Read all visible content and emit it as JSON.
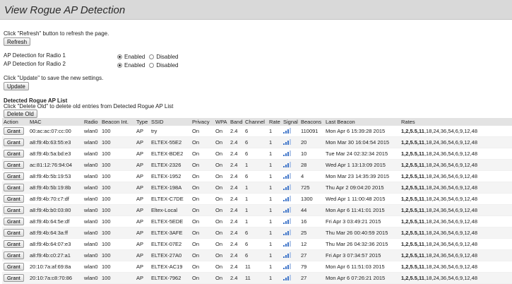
{
  "page": {
    "title": "View Rogue AP Detection",
    "refresh_hint": "Click \"Refresh\" button to refresh the page.",
    "refresh_label": "Refresh",
    "update_hint": "Click \"Update\" to save the new settings.",
    "update_label": "Update",
    "delete_hint": "Click \"Delete Old\" to delete old entries from Detected Rogue AP List",
    "delete_label": "Delete Old",
    "list_title": "Detected Rogue AP List"
  },
  "detection": [
    {
      "label": "AP Detection for Radio 1",
      "enabled": "Enabled",
      "disabled": "Disabled",
      "selected": "enabled"
    },
    {
      "label": "AP Detection for Radio 2",
      "enabled": "Enabled",
      "disabled": "Disabled",
      "selected": "enabled"
    }
  ],
  "table": {
    "headers": [
      "Action",
      "MAC",
      "Radio",
      "Beacon Int.",
      "Type",
      "SSID",
      "Privacy",
      "WPA",
      "Band",
      "Channel",
      "Rate",
      "Signal",
      "Beacons",
      "Last Beacon",
      "Rates"
    ],
    "rows": [
      {
        "action": "Grant",
        "mac": "00:ac:ac:07:cc:00",
        "radio": "wlan0",
        "beacon_int": "100",
        "type": "AP",
        "ssid": "try",
        "privacy": "On",
        "wpa": "On",
        "band": "2.4",
        "channel": "6",
        "rate": "1",
        "signal": "signal-bars-icon",
        "beacons": "110091",
        "last_beacon": "Mon Apr 6 15:39:28 2015",
        "rates_bold": "1,2,5.5,11",
        "rates_rest": ",18,24,36,54,6,9,12,48"
      },
      {
        "action": "Grant",
        "mac": "a8:f9:4b:63:55:e3",
        "radio": "wlan0",
        "beacon_int": "100",
        "type": "AP",
        "ssid": "ELTEX-55E2",
        "privacy": "On",
        "wpa": "On",
        "band": "2.4",
        "channel": "6",
        "rate": "1",
        "signal": "signal-bars-icon",
        "beacons": "20",
        "last_beacon": "Mon Mar 30 16:04:54 2015",
        "rates_bold": "1,2,5.5,11",
        "rates_rest": ",18,24,36,54,6,9,12,48"
      },
      {
        "action": "Grant",
        "mac": "a8:f9:4b:5a:bd:e3",
        "radio": "wlan0",
        "beacon_int": "100",
        "type": "AP",
        "ssid": "ELTEX-BDE2",
        "privacy": "On",
        "wpa": "On",
        "band": "2.4",
        "channel": "6",
        "rate": "1",
        "signal": "signal-bars-icon",
        "beacons": "10",
        "last_beacon": "Tue Mar 24 02:32:34 2015",
        "rates_bold": "1,2,5.5,11",
        "rates_rest": ",18,24,36,54,6,9,12,48"
      },
      {
        "action": "Grant",
        "mac": "ac:81:12:76:94:04",
        "radio": "wlan0",
        "beacon_int": "100",
        "type": "AP",
        "ssid": "ELTEX-2326",
        "privacy": "On",
        "wpa": "On",
        "band": "2.4",
        "channel": "1",
        "rate": "1",
        "signal": "signal-bars-icon",
        "beacons": "28",
        "last_beacon": "Wed Apr 1 13:13:09 2015",
        "rates_bold": "1,2,5.5,11",
        "rates_rest": ",18,24,36,54,6,9,12,48"
      },
      {
        "action": "Grant",
        "mac": "a8:f9:4b:5b:19:53",
        "radio": "wlan0",
        "beacon_int": "100",
        "type": "AP",
        "ssid": "ELTEX-1952",
        "privacy": "On",
        "wpa": "On",
        "band": "2.4",
        "channel": "6",
        "rate": "1",
        "signal": "signal-bars-icon",
        "beacons": "4",
        "last_beacon": "Mon Mar 23 14:35:39 2015",
        "rates_bold": "1,2,5.5,11",
        "rates_rest": ",18,24,36,54,6,9,12,48"
      },
      {
        "action": "Grant",
        "mac": "a8:f9:4b:5b:19:8b",
        "radio": "wlan0",
        "beacon_int": "100",
        "type": "AP",
        "ssid": "ELTEX-198A",
        "privacy": "On",
        "wpa": "On",
        "band": "2.4",
        "channel": "1",
        "rate": "1",
        "signal": "signal-bars-icon",
        "beacons": "725",
        "last_beacon": "Thu Apr 2 09:04:20 2015",
        "rates_bold": "1,2,5.5,11",
        "rates_rest": ",18,24,36,54,6,9,12,48"
      },
      {
        "action": "Grant",
        "mac": "a8:f9:4b:70:c7:df",
        "radio": "wlan0",
        "beacon_int": "100",
        "type": "AP",
        "ssid": "ELTEX-C7DE",
        "privacy": "On",
        "wpa": "On",
        "band": "2.4",
        "channel": "1",
        "rate": "1",
        "signal": "signal-bars-icon",
        "beacons": "1300",
        "last_beacon": "Wed Apr 1 11:00:48 2015",
        "rates_bold": "1,2,5.5,11",
        "rates_rest": ",18,24,36,54,6,9,12,48"
      },
      {
        "action": "Grant",
        "mac": "a8:f9:4b:b0:03:80",
        "radio": "wlan0",
        "beacon_int": "100",
        "type": "AP",
        "ssid": "Eltex-Local",
        "privacy": "On",
        "wpa": "On",
        "band": "2.4",
        "channel": "1",
        "rate": "1",
        "signal": "signal-bars-icon",
        "beacons": "44",
        "last_beacon": "Mon Apr 6 11:41:01 2015",
        "rates_bold": "1,2,5.5,11",
        "rates_rest": ",18,24,36,54,6,9,12,48"
      },
      {
        "action": "Grant",
        "mac": "a8:f9:4b:64:5e:df",
        "radio": "wlan0",
        "beacon_int": "100",
        "type": "AP",
        "ssid": "ELTEX-5EDE",
        "privacy": "On",
        "wpa": "On",
        "band": "2.4",
        "channel": "1",
        "rate": "1",
        "signal": "signal-bars-icon",
        "beacons": "16",
        "last_beacon": "Fri Apr 3 03:49:21 2015",
        "rates_bold": "1,2,5.5,11",
        "rates_rest": ",18,24,36,54,6,9,12,48"
      },
      {
        "action": "Grant",
        "mac": "a8:f9:4b:64:3a:ff",
        "radio": "wlan0",
        "beacon_int": "100",
        "type": "AP",
        "ssid": "ELTEX-3AFE",
        "privacy": "On",
        "wpa": "On",
        "band": "2.4",
        "channel": "6",
        "rate": "1",
        "signal": "signal-bars-icon",
        "beacons": "25",
        "last_beacon": "Thu Mar 26 00:40:59 2015",
        "rates_bold": "1,2,5.5,11",
        "rates_rest": ",18,24,36,54,6,9,12,48"
      },
      {
        "action": "Grant",
        "mac": "a8:f9:4b:64:07:e3",
        "radio": "wlan0",
        "beacon_int": "100",
        "type": "AP",
        "ssid": "ELTEX-07E2",
        "privacy": "On",
        "wpa": "On",
        "band": "2.4",
        "channel": "6",
        "rate": "1",
        "signal": "signal-bars-icon",
        "beacons": "12",
        "last_beacon": "Thu Mar 26 04:32:36 2015",
        "rates_bold": "1,2,5.5,11",
        "rates_rest": ",18,24,36,54,6,9,12,48"
      },
      {
        "action": "Grant",
        "mac": "a8:f9:4b:c0:27:a1",
        "radio": "wlan0",
        "beacon_int": "100",
        "type": "AP",
        "ssid": "ELTEX-27A0",
        "privacy": "On",
        "wpa": "On",
        "band": "2.4",
        "channel": "6",
        "rate": "1",
        "signal": "signal-bars-icon",
        "beacons": "27",
        "last_beacon": "Fri Apr 3 07:34:57 2015",
        "rates_bold": "1,2,5.5,11",
        "rates_rest": ",18,24,36,54,6,9,12,48"
      },
      {
        "action": "Grant",
        "mac": "20:10:7a:af:69:8a",
        "radio": "wlan0",
        "beacon_int": "100",
        "type": "AP",
        "ssid": "ELTEX-AC19",
        "privacy": "On",
        "wpa": "On",
        "band": "2.4",
        "channel": "11",
        "rate": "1",
        "signal": "signal-bars-icon",
        "beacons": "79",
        "last_beacon": "Mon Apr 6 11:51:03 2015",
        "rates_bold": "1,2,5.5,11",
        "rates_rest": ",18,24,36,54,6,9,12,48"
      },
      {
        "action": "Grant",
        "mac": "20:10:7a:c8:70:86",
        "radio": "wlan0",
        "beacon_int": "100",
        "type": "AP",
        "ssid": "ELTEX-7962",
        "privacy": "On",
        "wpa": "On",
        "band": "2.4",
        "channel": "11",
        "rate": "1",
        "signal": "signal-bars-icon",
        "beacons": "27",
        "last_beacon": "Mon Apr 6 07:26:21 2015",
        "rates_bold": "1,2,5.5,11",
        "rates_rest": ",18,24,36,54,6,9,12,48"
      }
    ]
  }
}
